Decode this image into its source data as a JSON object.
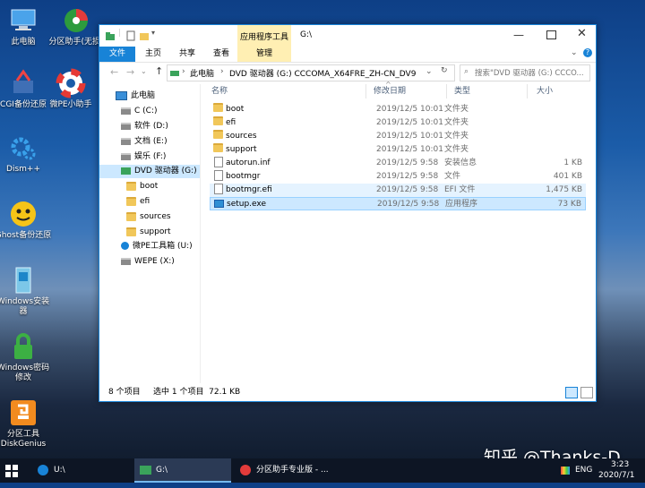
{
  "desktop": {
    "icons": [
      {
        "label": "此电脑"
      },
      {
        "label": "分区助手(无损)"
      },
      {
        "label": "CGI备份还原"
      },
      {
        "label": "微PE小助手"
      },
      {
        "label": "Dism++"
      },
      {
        "label": "Ghost备份还原"
      },
      {
        "label": "Windows安装器"
      },
      {
        "label": "Windows密码修改"
      },
      {
        "label": "分区工具DiskGenius"
      }
    ]
  },
  "window": {
    "title": "G:\\",
    "context_tab": "应用程序工具",
    "tabs": [
      {
        "label": "文件",
        "active": true
      },
      {
        "label": "主页"
      },
      {
        "label": "共享"
      },
      {
        "label": "查看"
      },
      {
        "label": "管理"
      }
    ],
    "address": {
      "root": "此电脑",
      "drive": "DVD 驱动器 (G:) CCCOMA_X64FRE_ZH-CN_DV9"
    },
    "search_placeholder": "搜索\"DVD 驱动器 (G:) CCCO...",
    "nav": [
      {
        "label": "此电脑",
        "type": "pc",
        "indent": 0
      },
      {
        "label": "C (C:)",
        "type": "drive",
        "indent": 1
      },
      {
        "label": "软件 (D:)",
        "type": "drive",
        "indent": 1
      },
      {
        "label": "文档 (E:)",
        "type": "drive",
        "indent": 1
      },
      {
        "label": "娱乐 (F:)",
        "type": "drive",
        "indent": 1
      },
      {
        "label": "DVD 驱动器 (G:) C",
        "type": "dvd",
        "indent": 1,
        "selected": true
      },
      {
        "label": "boot",
        "type": "folder",
        "indent": 2
      },
      {
        "label": "efi",
        "type": "folder",
        "indent": 2
      },
      {
        "label": "sources",
        "type": "folder",
        "indent": 2
      },
      {
        "label": "support",
        "type": "folder",
        "indent": 2
      },
      {
        "label": "微PE工具箱 (U:)",
        "type": "usb",
        "indent": 1
      },
      {
        "label": "WEPE (X:)",
        "type": "drive",
        "indent": 1
      }
    ],
    "columns": {
      "name": "名称",
      "modified": "修改日期",
      "type": "类型",
      "size": "大小"
    },
    "files": [
      {
        "name": "boot",
        "modified": "2019/12/5 10:01",
        "type": "文件夹",
        "size": "",
        "icon": "folder"
      },
      {
        "name": "efi",
        "modified": "2019/12/5 10:01",
        "type": "文件夹",
        "size": "",
        "icon": "folder"
      },
      {
        "name": "sources",
        "modified": "2019/12/5 10:01",
        "type": "文件夹",
        "size": "",
        "icon": "folder"
      },
      {
        "name": "support",
        "modified": "2019/12/5 10:01",
        "type": "文件夹",
        "size": "",
        "icon": "folder"
      },
      {
        "name": "autorun.inf",
        "modified": "2019/12/5 9:58",
        "type": "安装信息",
        "size": "1 KB",
        "icon": "inf"
      },
      {
        "name": "bootmgr",
        "modified": "2019/12/5 9:58",
        "type": "文件",
        "size": "401 KB",
        "icon": "file"
      },
      {
        "name": "bootmgr.efi",
        "modified": "2019/12/5 9:58",
        "type": "EFI 文件",
        "size": "1,475 KB",
        "icon": "file"
      },
      {
        "name": "setup.exe",
        "modified": "2019/12/5 9:58",
        "type": "应用程序",
        "size": "73 KB",
        "icon": "exe"
      }
    ],
    "status": {
      "count": "8 个项目",
      "selection": "选中 1 个项目  72.1 KB"
    }
  },
  "taskbar": {
    "items": [
      {
        "label": "U:\\"
      },
      {
        "label": "G:\\"
      },
      {
        "label": "分区助手专业版 - ..."
      }
    ],
    "lang": "ENG",
    "time": "3:23",
    "date": "2020/7/1"
  },
  "watermark": "知乎 @Thanks-D",
  "colors": {
    "accent": "#1883d7",
    "selected_row": "#cce8ff",
    "context_tab": "#ffefb3",
    "folder": "#f1c75a"
  }
}
